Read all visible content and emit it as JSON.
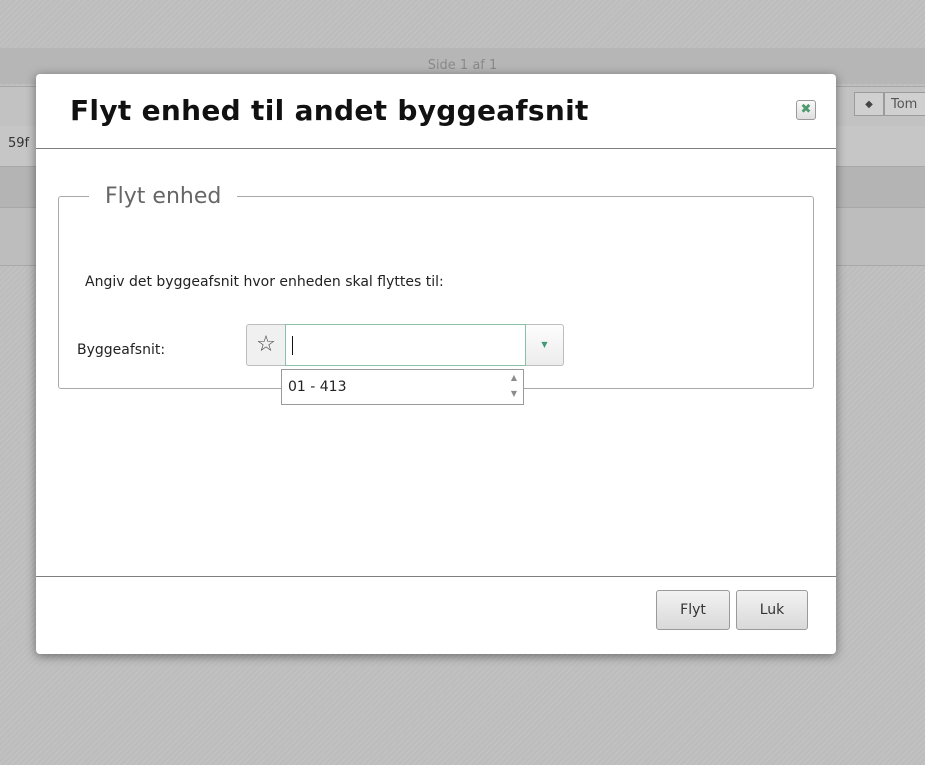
{
  "background": {
    "pagination_text": "Side 1 af 1",
    "row_fragment": "59f",
    "column_sort_glyph": "◆",
    "column_header": "Tom"
  },
  "modal": {
    "title": "Flyt enhed til andet byggeafsnit",
    "close_icon": "close-icon",
    "fieldset_legend": "Flyt enhed",
    "instruction": "Angiv det byggeafsnit hvor enheden skal flyttes til:",
    "field_label": "Byggeafsnit:",
    "favorite_icon": "star-outline-icon",
    "input_value": "",
    "dropdown_options": [
      "01 - 413"
    ],
    "buttons": {
      "move": "Flyt",
      "close": "Luk"
    }
  },
  "colors": {
    "accent": "#3f9b72",
    "overlay": "#bdbdbd"
  }
}
